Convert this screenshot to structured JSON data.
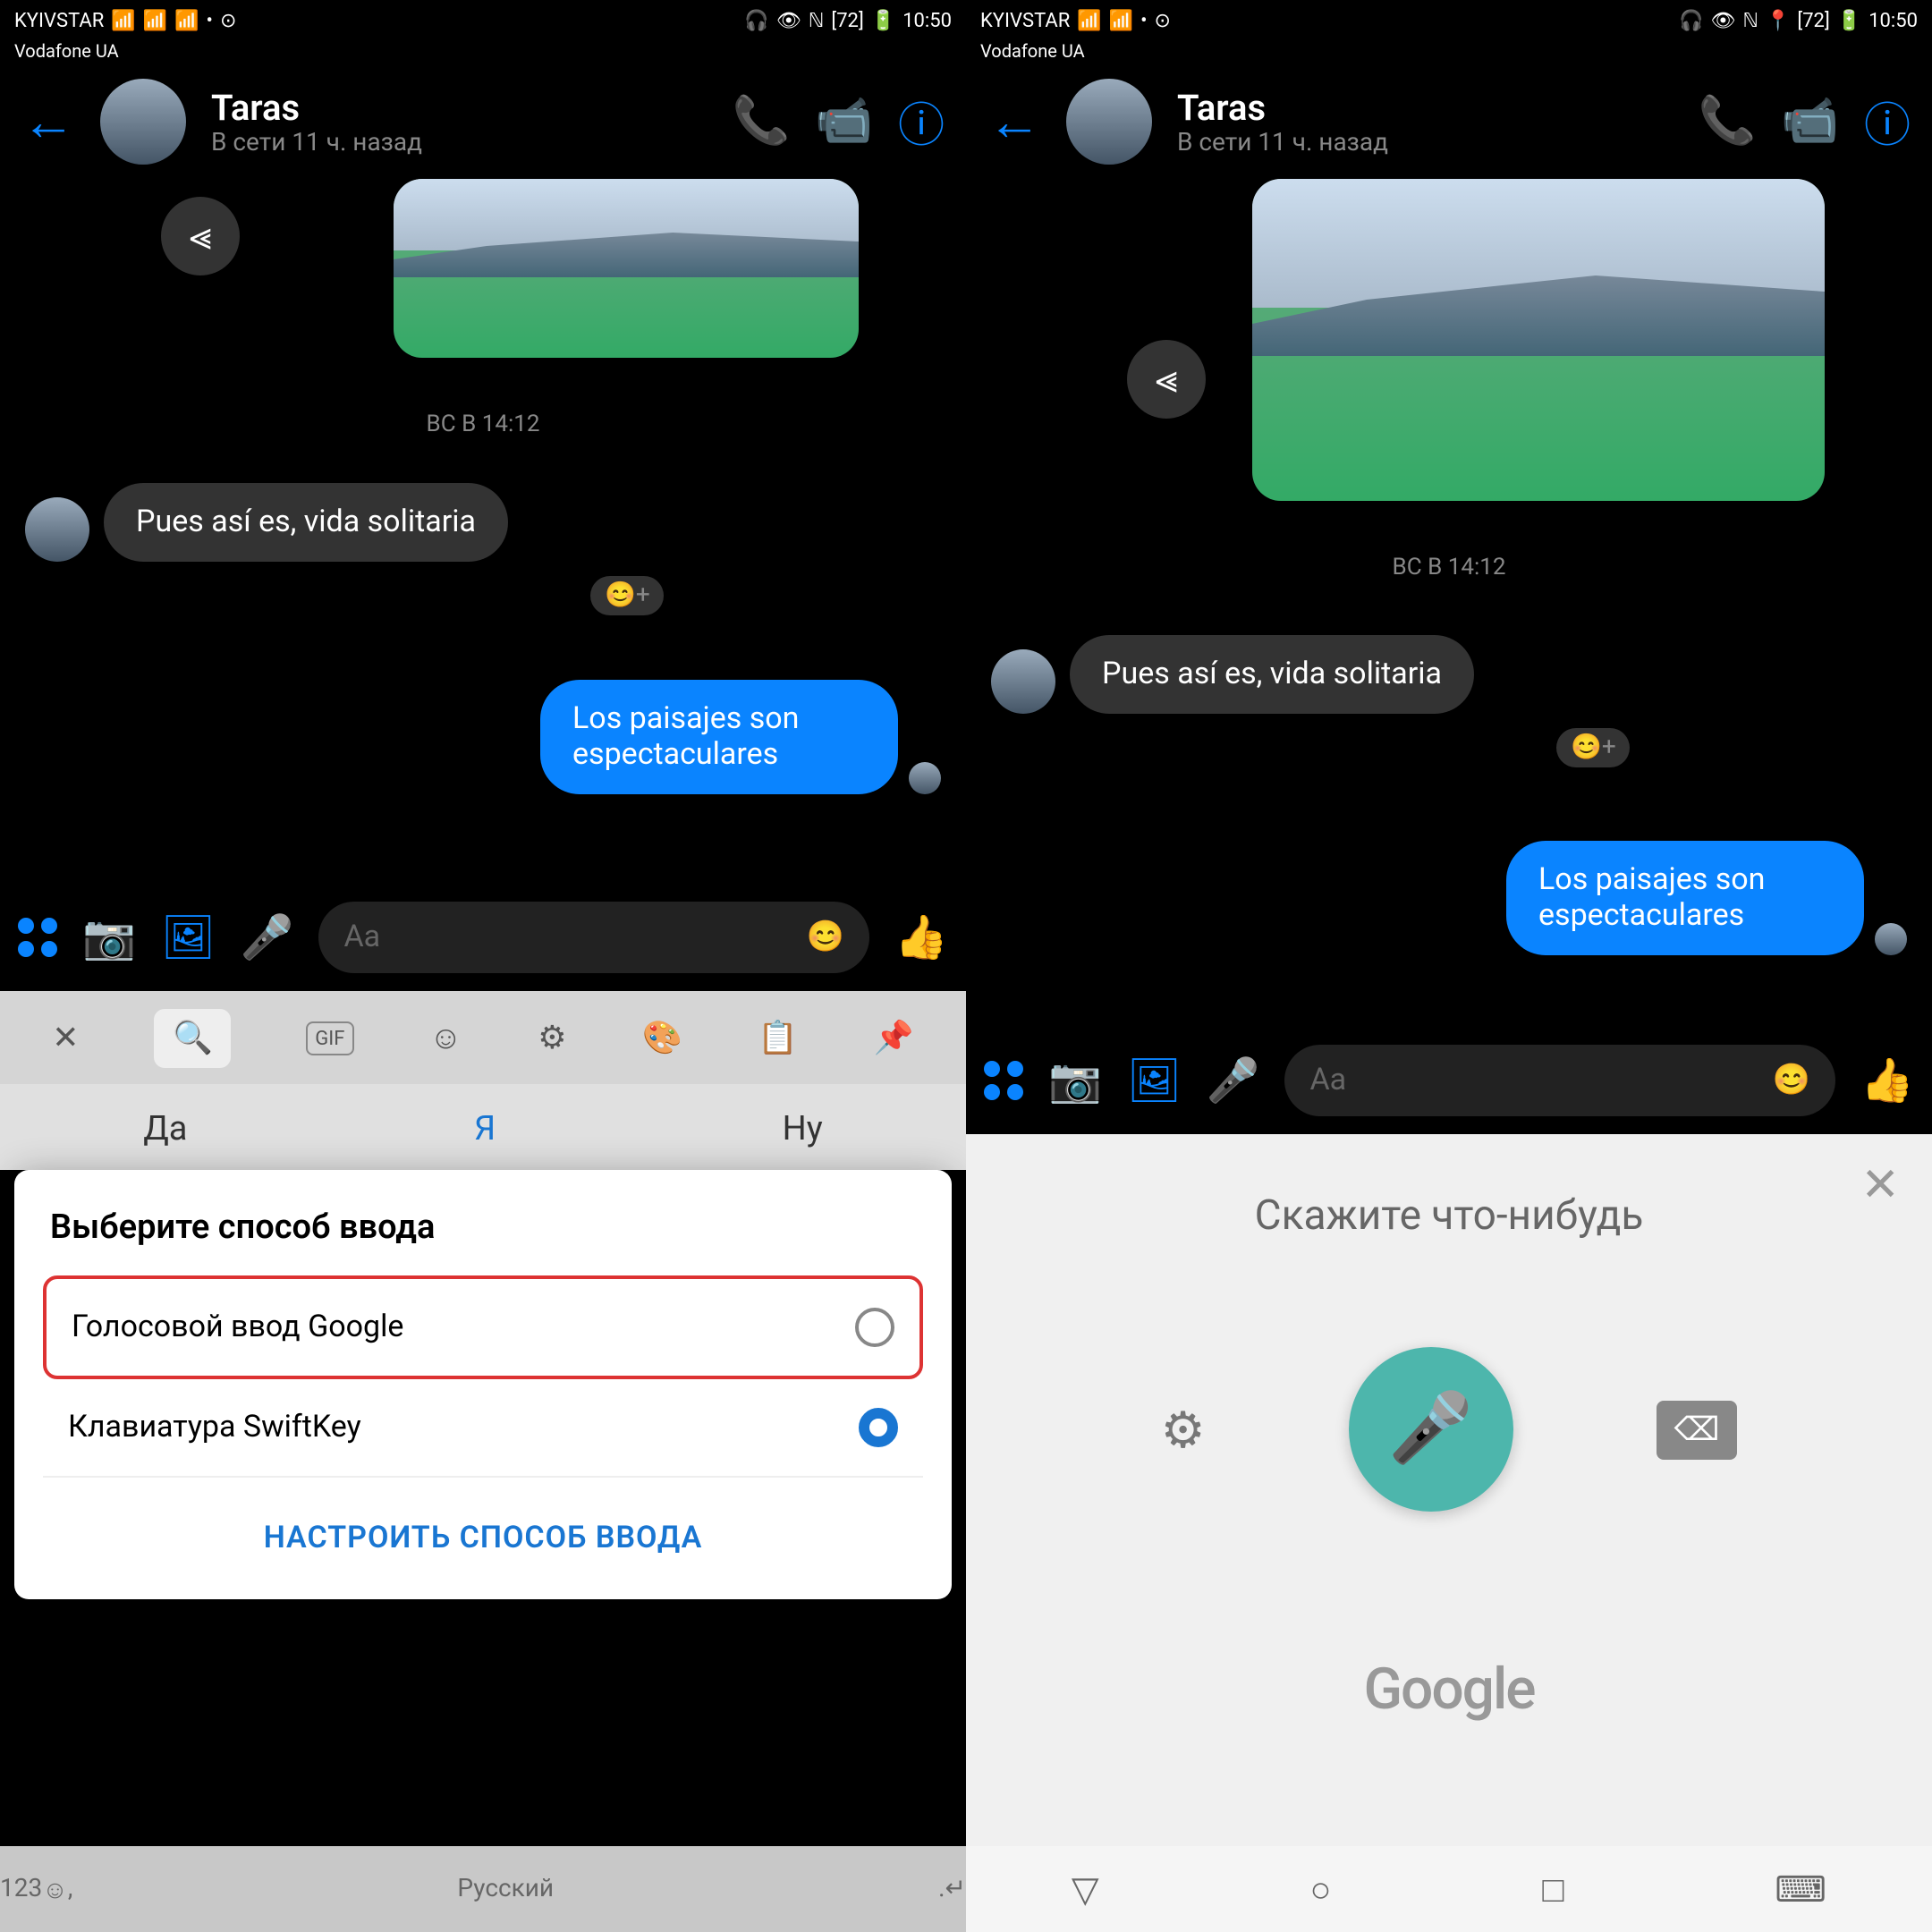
{
  "status": {
    "carrier1": "KYIVSTAR",
    "carrier2": "Vodafone UA",
    "battery": "72",
    "time": "10:50"
  },
  "header": {
    "name": "Taras",
    "status": "В сети 11 ч. назад"
  },
  "chat": {
    "timestamp": "ВС В 14:12",
    "msg_in": "Pues así es, vida solitaria",
    "msg_out": "Los paisajes son espectaculares",
    "react": "😊+"
  },
  "input": {
    "placeholder": "Aa"
  },
  "keyboard": {
    "sug1": "Да",
    "sug2": "Я",
    "sug3": "Ну",
    "lang": "Русский",
    "num": "123"
  },
  "modal": {
    "title": "Выберите способ ввода",
    "opt1": "Голосовой ввод Google",
    "opt2": "Клавиатура SwiftKey",
    "btn": "НАСТРОИТЬ СПОСОБ ВВОДА"
  },
  "voice": {
    "prompt": "Скажите что-нибудь",
    "brand": "Google"
  }
}
